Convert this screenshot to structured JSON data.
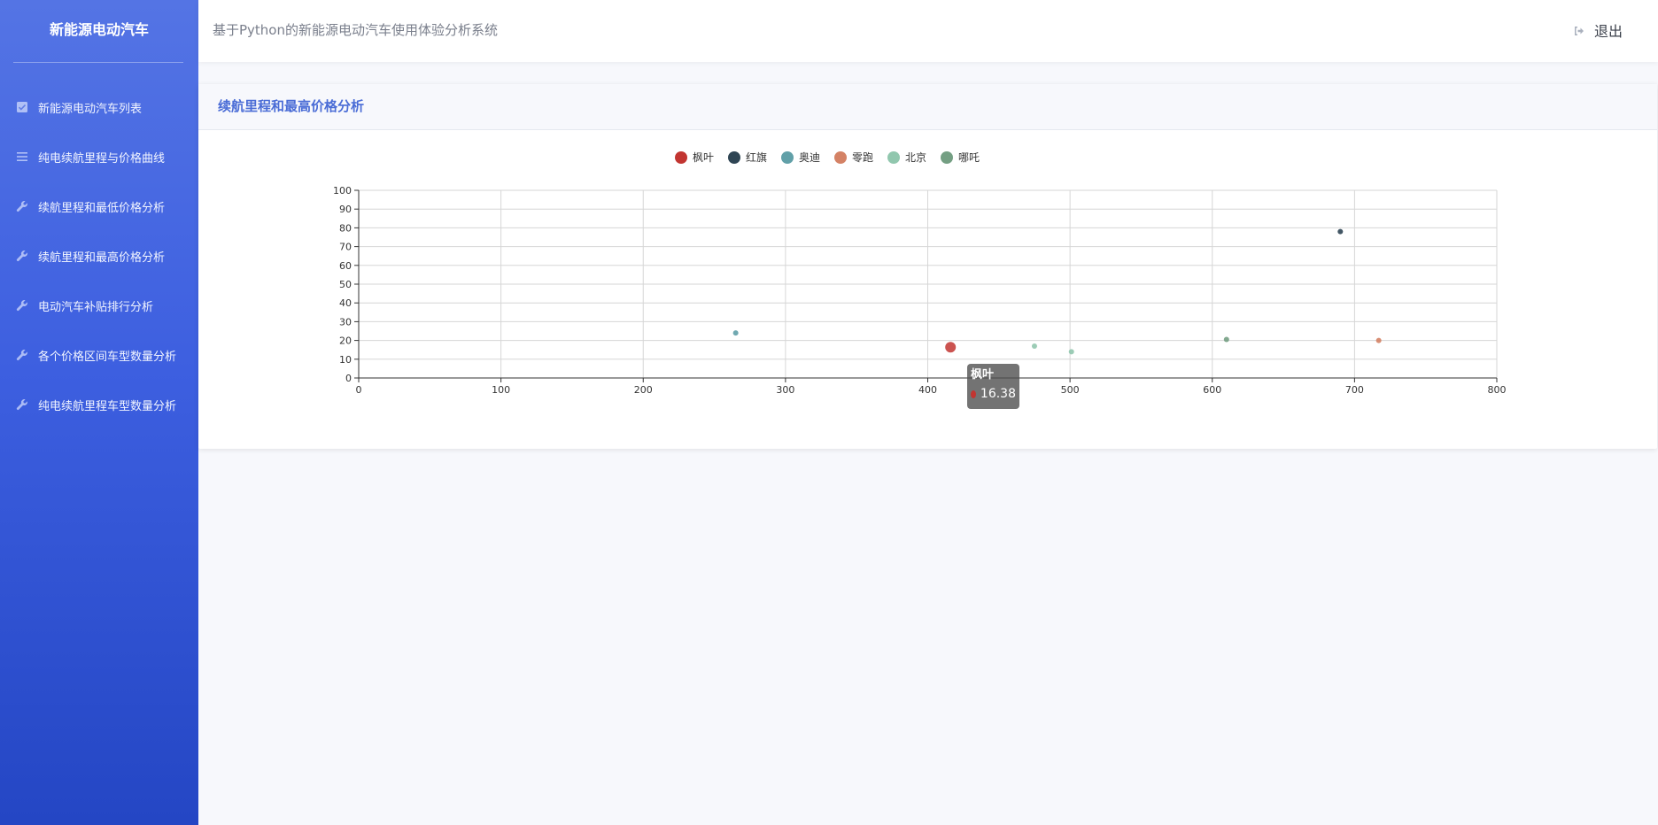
{
  "app": {
    "brand": "新能源电动汽车",
    "header_title": "基于Python的新能源电动汽车使用体验分析系统",
    "logout_label": "退出"
  },
  "sidebar": {
    "items": [
      {
        "label": "新能源电动汽车列表",
        "icon": "checkbox-icon"
      },
      {
        "label": "纯电续航里程与价格曲线",
        "icon": "list-icon"
      },
      {
        "label": "续航里程和最低价格分析",
        "icon": "wrench-icon"
      },
      {
        "label": "续航里程和最高价格分析",
        "icon": "wrench-icon"
      },
      {
        "label": "电动汽车补贴排行分析",
        "icon": "wrench-icon"
      },
      {
        "label": "各个价格区间车型数量分析",
        "icon": "wrench-icon"
      },
      {
        "label": "纯电续航里程车型数量分析",
        "icon": "wrench-icon"
      }
    ]
  },
  "card": {
    "title": "续航里程和最高价格分析"
  },
  "chart_data": {
    "type": "scatter",
    "xlim": [
      0,
      800
    ],
    "ylim": [
      0,
      100
    ],
    "x_ticks": [
      0,
      100,
      200,
      300,
      400,
      500,
      600,
      700,
      800
    ],
    "y_ticks": [
      0,
      10,
      20,
      30,
      40,
      50,
      60,
      70,
      80,
      90,
      100
    ],
    "grid": true,
    "legend_position": "top-center",
    "series": [
      {
        "name": "枫叶",
        "color": "#c23531",
        "points": [
          [
            416,
            16.38
          ]
        ]
      },
      {
        "name": "红旗",
        "color": "#2f4554",
        "points": [
          [
            690,
            78
          ]
        ]
      },
      {
        "name": "奥迪",
        "color": "#61a0a8",
        "points": [
          [
            265,
            24
          ]
        ]
      },
      {
        "name": "零跑",
        "color": "#d48265",
        "points": [
          [
            717,
            20
          ]
        ]
      },
      {
        "name": "北京",
        "color": "#91c7ae",
        "points": [
          [
            475,
            17
          ],
          [
            501,
            14
          ]
        ]
      },
      {
        "name": "哪吒",
        "color": "#749f83",
        "points": [
          [
            610,
            20.5
          ]
        ]
      }
    ],
    "tooltip": {
      "series": "枫叶",
      "value": "16.38"
    }
  }
}
